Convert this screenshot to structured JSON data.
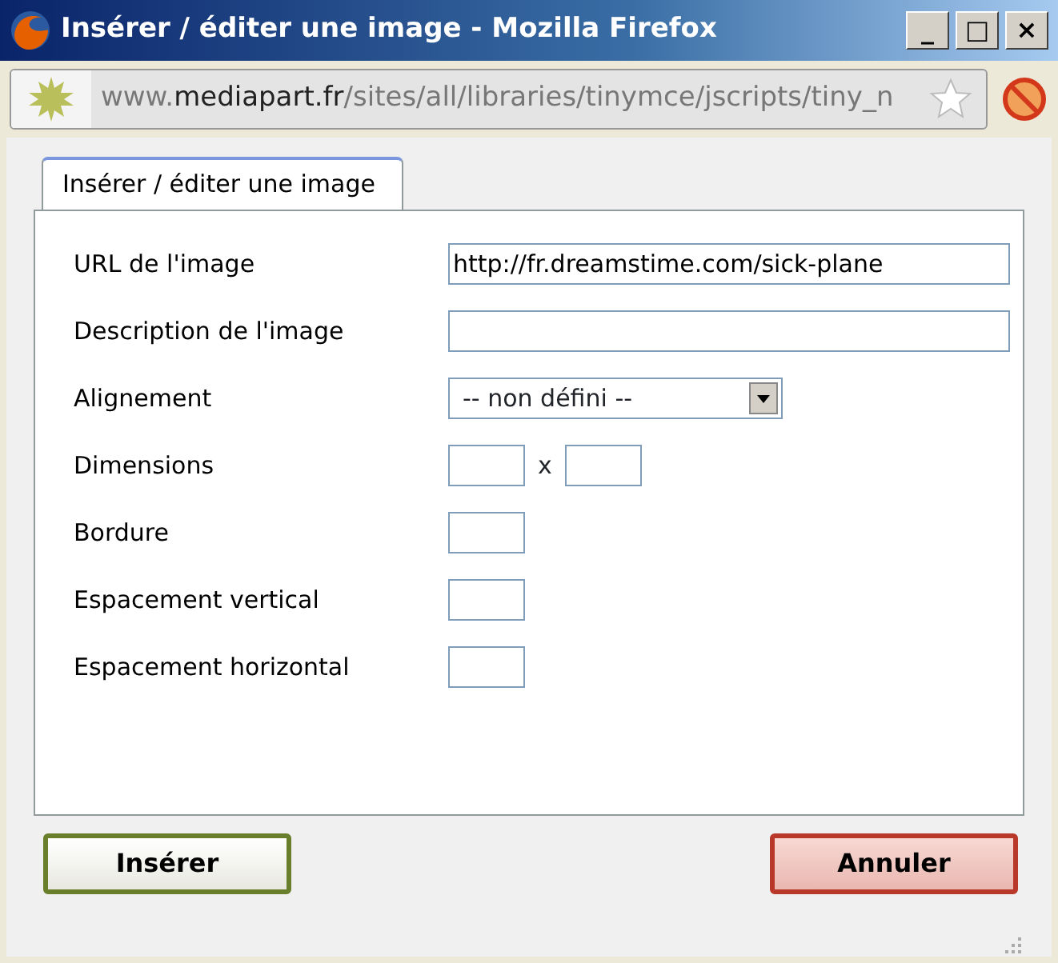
{
  "window": {
    "title": "Insérer / éditer une image - Mozilla Firefox",
    "buttons": [
      "_",
      "□",
      "×"
    ]
  },
  "address_bar": {
    "prefix": "www.",
    "domain": "mediapart.fr",
    "path": "/sites/all/libraries/tinymce/jscripts/tiny_n"
  },
  "tabs": [
    {
      "label": "Insérer / éditer une image",
      "selected": true
    }
  ],
  "fields": [
    {
      "label": "URL de l'image",
      "kind": "text",
      "value": "http://fr.dreamstime.com/sick-plane"
    },
    {
      "label": "Description de l'image",
      "kind": "text"
    },
    {
      "label": "Alignement",
      "kind": "select",
      "value": "-- non défini --"
    },
    {
      "label": "Dimensions",
      "kind": "pair",
      "separator": "x"
    },
    {
      "label": "Bordure",
      "kind": "small"
    },
    {
      "label": "Espacement vertical",
      "kind": "small"
    },
    {
      "label": "Espacement horizontal",
      "kind": "small"
    }
  ],
  "buttons": [
    {
      "label": "Insérer",
      "kind": "ok"
    },
    {
      "label": "Annuler",
      "kind": "cancel"
    }
  ]
}
